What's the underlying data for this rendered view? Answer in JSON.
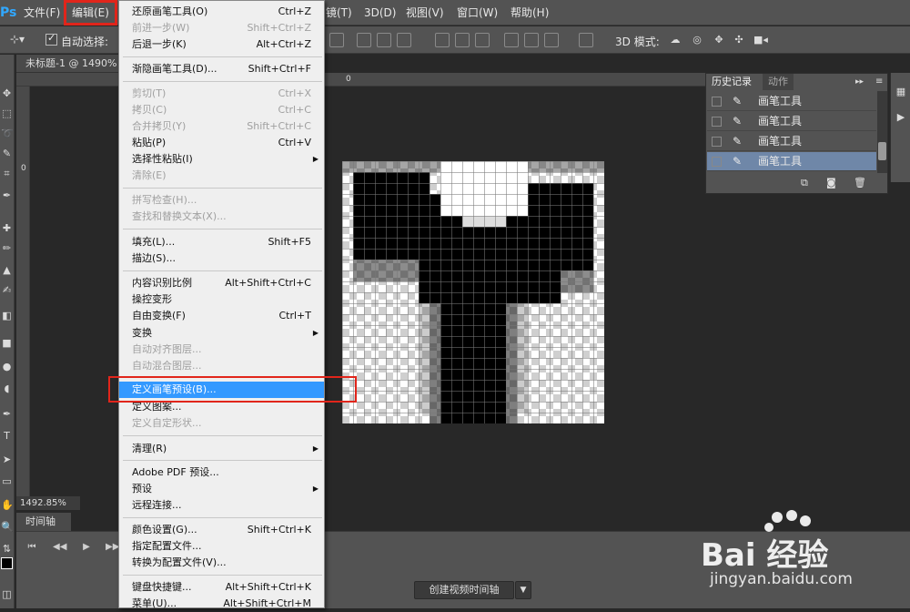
{
  "menubar": {
    "app_icon": "Ps",
    "items": [
      {
        "label": "文件(F)"
      },
      {
        "label": "编辑(E)"
      },
      {
        "label": "镜(T)"
      },
      {
        "label": "3D(D)"
      },
      {
        "label": "视图(V)"
      },
      {
        "label": "窗口(W)"
      },
      {
        "label": "帮助(H)"
      }
    ]
  },
  "options_bar": {
    "auto_select_label": "自动选择:",
    "mode3d_label": "3D 模式:"
  },
  "document": {
    "tab_title": "未标题-1 @ 1490%",
    "zoom": "1492.85%",
    "ruler_h_zero": "0",
    "ruler_v_zero": "0"
  },
  "timeline": {
    "tab_label": "时间轴",
    "create_button": "创建视频时间轴"
  },
  "history_panel": {
    "tab_history": "历史记录",
    "tab_actions": "动作",
    "rows": [
      {
        "label": "画笔工具"
      },
      {
        "label": "画笔工具"
      },
      {
        "label": "画笔工具"
      },
      {
        "label": "画笔工具"
      }
    ]
  },
  "edit_menu": {
    "items": [
      {
        "label": "还原画笔工具(O)",
        "shortcut": "Ctrl+Z"
      },
      {
        "label": "前进一步(W)",
        "shortcut": "Shift+Ctrl+Z"
      },
      {
        "label": "后退一步(K)",
        "shortcut": "Alt+Ctrl+Z"
      },
      {
        "label": "渐隐画笔工具(D)...",
        "shortcut": "Shift+Ctrl+F"
      },
      {
        "label": "剪切(T)",
        "shortcut": "Ctrl+X"
      },
      {
        "label": "拷贝(C)",
        "shortcut": "Ctrl+C"
      },
      {
        "label": "合并拷贝(Y)",
        "shortcut": "Shift+Ctrl+C"
      },
      {
        "label": "粘贴(P)",
        "shortcut": "Ctrl+V"
      },
      {
        "label": "选择性粘贴(I)",
        "shortcut": ""
      },
      {
        "label": "清除(E)",
        "shortcut": ""
      },
      {
        "label": "拼写检查(H)...",
        "shortcut": ""
      },
      {
        "label": "查找和替换文本(X)...",
        "shortcut": ""
      },
      {
        "label": "填充(L)...",
        "shortcut": "Shift+F5"
      },
      {
        "label": "描边(S)...",
        "shortcut": ""
      },
      {
        "label": "内容识别比例",
        "shortcut": "Alt+Shift+Ctrl+C"
      },
      {
        "label": "操控变形",
        "shortcut": ""
      },
      {
        "label": "自由变换(F)",
        "shortcut": "Ctrl+T"
      },
      {
        "label": "变换",
        "shortcut": ""
      },
      {
        "label": "自动对齐图层...",
        "shortcut": ""
      },
      {
        "label": "自动混合图层...",
        "shortcut": ""
      },
      {
        "label": "定义画笔预设(B)...",
        "shortcut": ""
      },
      {
        "label": "定义图案...",
        "shortcut": ""
      },
      {
        "label": "定义自定形状...",
        "shortcut": ""
      },
      {
        "label": "清理(R)",
        "shortcut": ""
      },
      {
        "label": "Adobe PDF 预设...",
        "shortcut": ""
      },
      {
        "label": "预设",
        "shortcut": ""
      },
      {
        "label": "远程连接...",
        "shortcut": ""
      },
      {
        "label": "颜色设置(G)...",
        "shortcut": "Shift+Ctrl+K"
      },
      {
        "label": "指定配置文件...",
        "shortcut": ""
      },
      {
        "label": "转换为配置文件(V)...",
        "shortcut": ""
      },
      {
        "label": "键盘快捷键...",
        "shortcut": "Alt+Shift+Ctrl+K"
      },
      {
        "label": "菜单(U)...",
        "shortcut": "Alt+Shift+Ctrl+M"
      }
    ]
  },
  "watermark": {
    "brand": "Bai 经验",
    "url": "jingyan.baidu.com"
  },
  "colors": {
    "highlight": "#3399ff",
    "annotation_red": "#e1251b",
    "history_selected": "#6f87a8"
  }
}
